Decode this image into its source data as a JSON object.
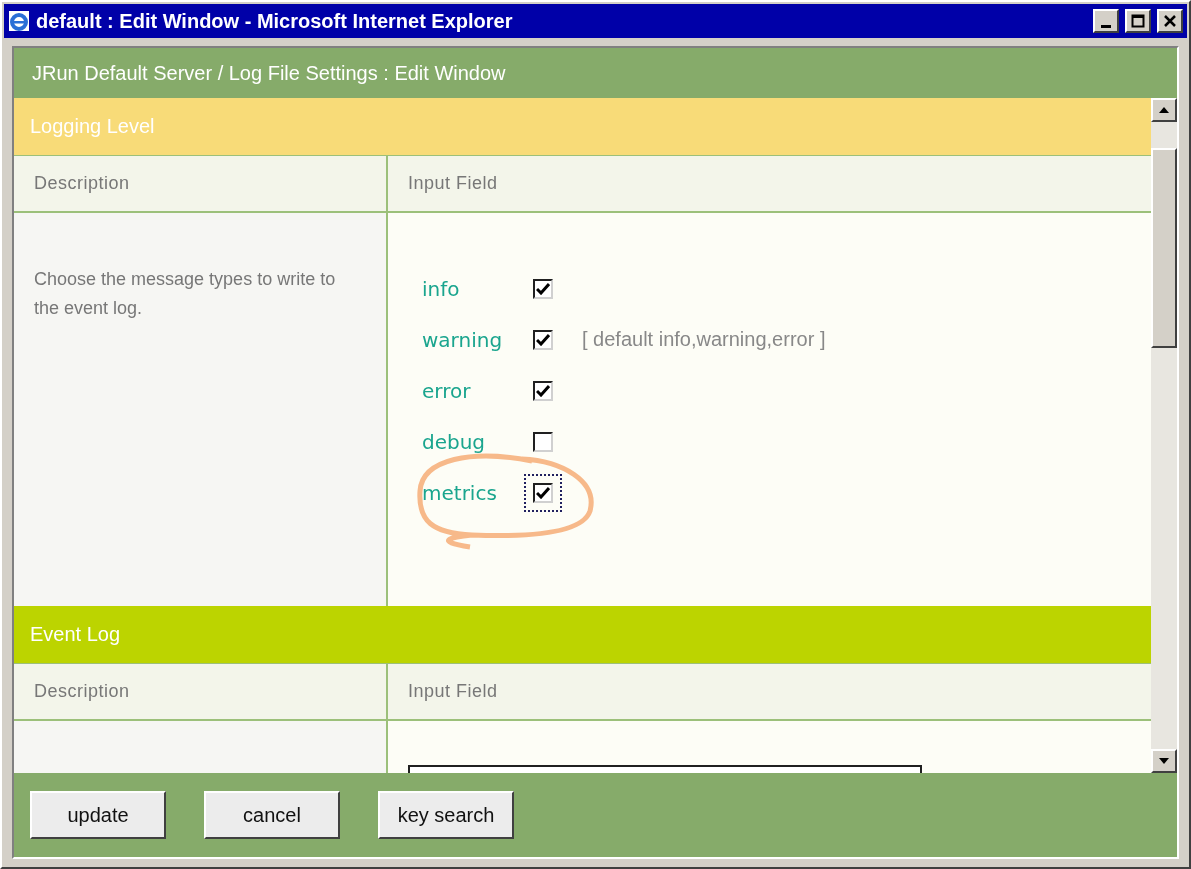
{
  "window": {
    "title": "default : Edit Window - Microsoft Internet Explorer"
  },
  "page_title": "JRun Default Server / Log File Settings : Edit Window",
  "sections": [
    {
      "title": "Logging Level",
      "kind": "levels",
      "columns": [
        "Description",
        "Input Field"
      ],
      "description": "Choose the message types to write to the event log.",
      "note": "[ default  info,warning,error ]",
      "options": [
        {
          "label": "info",
          "checked": true,
          "focused": false
        },
        {
          "label": "warning",
          "checked": true,
          "focused": false
        },
        {
          "label": "error",
          "checked": true,
          "focused": false
        },
        {
          "label": "debug",
          "checked": false,
          "focused": false
        },
        {
          "label": "metrics",
          "checked": true,
          "focused": true
        }
      ]
    },
    {
      "title": "Event Log",
      "kind": "field",
      "columns": [
        "Description",
        "Input Field"
      ]
    }
  ],
  "buttons": [
    "update",
    "cancel",
    "key search"
  ]
}
